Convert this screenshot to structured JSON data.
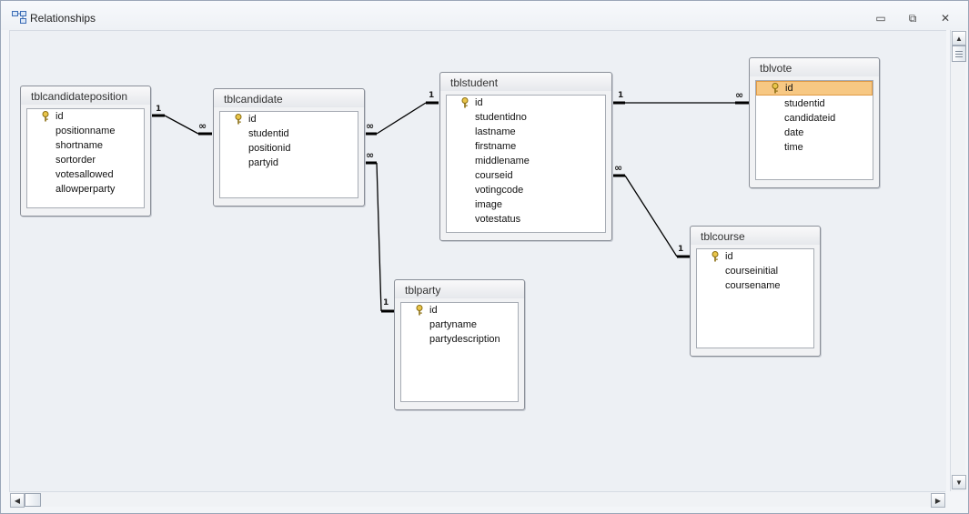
{
  "window": {
    "title": "Relationships",
    "buttons": {
      "minimize": "▭",
      "restore": "⧉",
      "close": "✕"
    }
  },
  "colors": {
    "selected_row": "#f7c883",
    "canvas": "#edf0f4",
    "line": "#000000"
  },
  "tables": [
    {
      "name": "tblcandidateposition",
      "fields": [
        "id",
        "positionname",
        "shortname",
        "sortorder",
        "votesallowed",
        "allowperparty"
      ],
      "key_field": "id"
    },
    {
      "name": "tblcandidate",
      "fields": [
        "id",
        "studentid",
        "positionid",
        "partyid"
      ],
      "key_field": "id"
    },
    {
      "name": "tblstudent",
      "fields": [
        "id",
        "studentidno",
        "lastname",
        "firstname",
        "middlename",
        "courseid",
        "votingcode",
        "image",
        "votestatus"
      ],
      "key_field": "id"
    },
    {
      "name": "tblvote",
      "fields": [
        "id",
        "studentid",
        "candidateid",
        "date",
        "time"
      ],
      "key_field": "id",
      "selected_field": "id"
    },
    {
      "name": "tblcourse",
      "fields": [
        "id",
        "courseinitial",
        "coursename"
      ],
      "key_field": "id"
    },
    {
      "name": "tblparty",
      "fields": [
        "id",
        "partyname",
        "partydescription"
      ],
      "key_field": "id"
    }
  ],
  "relationships": [
    {
      "from": "tblcandidateposition",
      "to": "tblcandidate",
      "from_mult": "1",
      "to_mult": "∞"
    },
    {
      "from": "tblstudent",
      "to": "tblcandidate",
      "from_mult": "1",
      "to_mult": "∞"
    },
    {
      "from": "tblparty",
      "to": "tblcandidate",
      "from_mult": "1",
      "to_mult": "∞"
    },
    {
      "from": "tblstudent",
      "to": "tblvote",
      "from_mult": "1",
      "to_mult": "∞"
    },
    {
      "from": "tblcourse",
      "to": "tblstudent",
      "from_mult": "1",
      "to_mult": "∞"
    }
  ],
  "icons": {
    "app": "relationships-icon",
    "key": "primary-key-icon"
  }
}
